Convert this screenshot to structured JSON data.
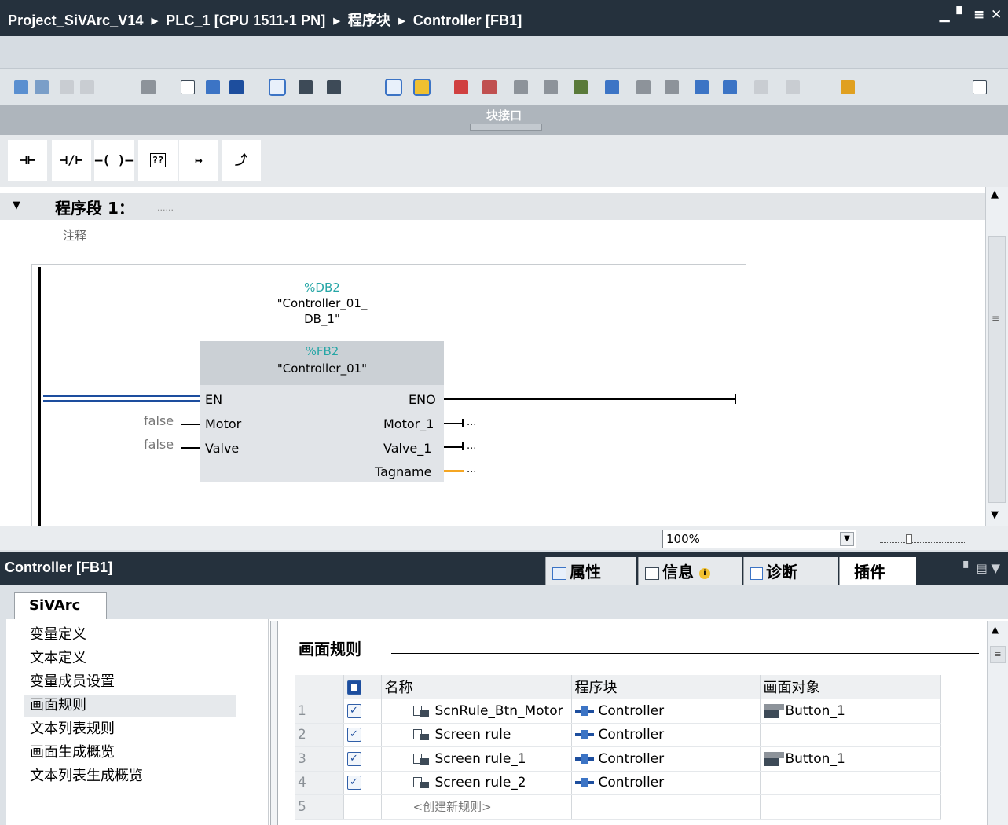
{
  "breadcrumb": [
    "Project_SiVArc_V14",
    "PLC_1 [CPU 1511-1 PN]",
    "程序块",
    "Controller [FB1]"
  ],
  "block_interface_label": "块接口",
  "ladder_toolbar": [
    "⊣⊢",
    "⊣/⊢",
    "–( )–",
    "??",
    "↦",
    "⤴"
  ],
  "network": {
    "title": "程序段 1：",
    "title_dots": "......",
    "comment": "注释",
    "instance_db_addr": "%DB2",
    "instance_db_name_1": "\"Controller_01_",
    "instance_db_name_2": "DB_1\"",
    "fb_addr": "%FB2",
    "fb_name": "\"Controller_01\"",
    "in_pins": [
      "EN",
      "Motor",
      "Valve"
    ],
    "out_pins": [
      "ENO",
      "Motor_1",
      "Valve_1",
      "Tagname"
    ],
    "in_values": [
      "false",
      "false"
    ],
    "out_values": [
      "...",
      "...",
      "..."
    ]
  },
  "zoom": "100%",
  "inspector": {
    "title": "Controller [FB1]",
    "tabs": [
      "属性",
      "信息",
      "诊断",
      "插件"
    ],
    "active_tab": "插件",
    "plugin_tab": "SiVArc"
  },
  "nav": [
    "变量定义",
    "文本定义",
    "变量成员设置",
    "画面规则",
    "文本列表规则",
    "画面生成概览",
    "文本列表生成概览"
  ],
  "rules": {
    "title": "画面规则",
    "columns": [
      "名称",
      "程序块",
      "画面对象"
    ],
    "rows": [
      {
        "num": "1",
        "name": "ScnRule_Btn_Motor",
        "block": "Controller",
        "object": "Button_1"
      },
      {
        "num": "2",
        "name": "Screen rule",
        "block": "Controller",
        "object": ""
      },
      {
        "num": "3",
        "name": "Screen rule_1",
        "block": "Controller",
        "object": "Button_1"
      },
      {
        "num": "4",
        "name": "Screen rule_2",
        "block": "Controller",
        "object": ""
      }
    ],
    "new_row_num": "5",
    "new_rule": "<创建新规则>"
  }
}
